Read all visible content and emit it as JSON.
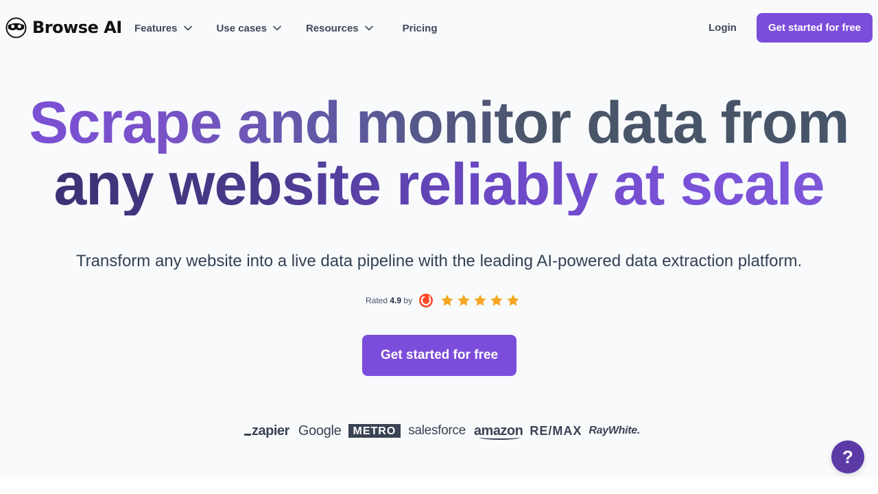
{
  "header": {
    "logo_text": "Browse AI",
    "menu": [
      {
        "label": "Features",
        "has_dropdown": true
      },
      {
        "label": "Use cases",
        "has_dropdown": true
      },
      {
        "label": "Resources",
        "has_dropdown": true
      },
      {
        "label": "Pricing",
        "has_dropdown": false
      }
    ],
    "login_label": "Login",
    "cta_label": "Get started for free"
  },
  "hero": {
    "title_line1": "Scrape and monitor data from",
    "title_line2": "any website reliably at scale",
    "subtitle": "Transform any website into a live data pipeline with the leading AI-powered data extraction platform.",
    "rating": {
      "prefix": "Rated",
      "score": "4.9",
      "suffix": "by",
      "provider_icon": "g2-icon",
      "stars": 5
    },
    "cta_label": "Get started for free"
  },
  "customer_logos": [
    "zapier",
    "Google",
    "METRO",
    "salesforce",
    "amazon",
    "RE/MAX",
    "RayWhite."
  ],
  "help": {
    "label": "?"
  },
  "colors": {
    "brand_purple": "#7c4ddb",
    "help_purple": "#5b3aa6",
    "star": "#f5a623",
    "background": "#f8fafc"
  }
}
